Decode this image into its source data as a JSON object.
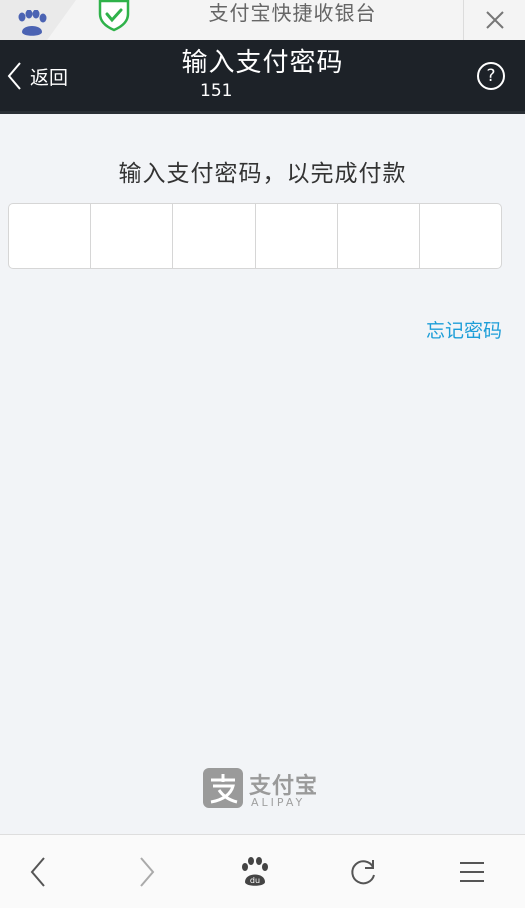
{
  "browser_tab": {
    "title": "支付宝快捷收银台",
    "icons": [
      "paw-icon",
      "shield-check-icon",
      "close-icon"
    ]
  },
  "header": {
    "back_label": "返回",
    "title": "输入支付密码",
    "subtitle": "151",
    "help_label": "?"
  },
  "content": {
    "instruction": "输入支付密码，以完成付款",
    "password_length": 6,
    "forgot_label": "忘记密码"
  },
  "brand": {
    "name_cn": "支付宝",
    "name_en": "ALIPAY"
  },
  "bottom_nav": {
    "items": [
      "back-icon",
      "forward-icon",
      "baidu-paw-icon",
      "refresh-icon",
      "menu-icon"
    ]
  },
  "colors": {
    "header_bg": "#1d2228",
    "link": "#1d9ed8",
    "shield": "#2fb24a",
    "page_bg": "#f2f4f7"
  }
}
